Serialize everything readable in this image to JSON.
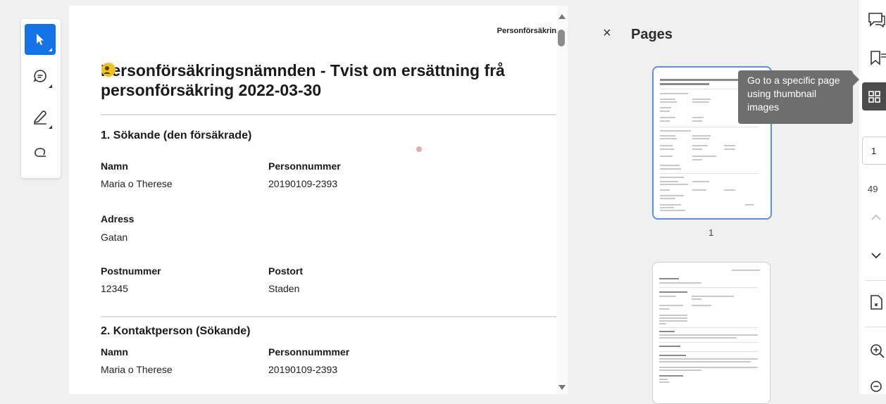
{
  "tools": {
    "select": "select-tool",
    "comment": "comment-tool",
    "draw": "draw-tool",
    "lasso": "lasso-tool"
  },
  "document": {
    "header": "Personförsäkrin",
    "title_line1": "Personförsäkringsnämnden - Tvist om ersättning frå",
    "title_line2": "personförsäkring 2022-03-30",
    "section1": {
      "heading": "1. Sökande (den försäkrade)",
      "name_label": "Namn",
      "name_value": "Maria o Therese",
      "pnr_label": "Personnummer",
      "pnr_value": "20190109-2393",
      "address_label": "Adress",
      "address_value": "Gatan",
      "zip_label": "Postnummer",
      "zip_value": "12345",
      "city_label": "Postort",
      "city_value": "Staden"
    },
    "section2": {
      "heading": "2. Kontaktperson (Sökande)",
      "name_label": "Namn",
      "name_value": "Maria o Therese",
      "pnr_label": "Personnummmer",
      "pnr_value": "20190109-2393"
    }
  },
  "pages_panel": {
    "close_glyph": "×",
    "title": "Pages",
    "thumb1_label": "1"
  },
  "tooltip": {
    "text": "Go to a specific page using thumbnail images"
  },
  "rail": {
    "current_page": "1",
    "total_pages": "49"
  },
  "colors": {
    "accent": "#1473e6",
    "tooltip_bg": "#6e6e6e",
    "thumb_selected": "#5a8fe6"
  }
}
